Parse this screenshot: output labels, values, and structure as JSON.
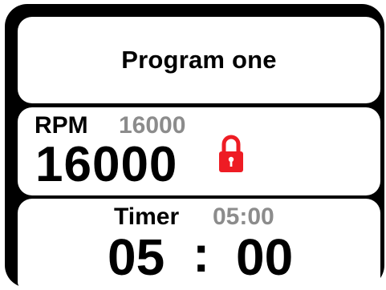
{
  "program": {
    "title": "Program one"
  },
  "rpm": {
    "label": "RPM",
    "setpoint": "16000",
    "value": "16000",
    "lock_icon": "lock-icon",
    "lock_color": "#ee1c24"
  },
  "timer": {
    "label": "Timer",
    "setpoint": "05:00",
    "minutes": "05",
    "separator": ":",
    "seconds": "00"
  },
  "colors": {
    "frame": "#000000",
    "panel": "#ffffff",
    "setpoint_text": "#8c8c8c"
  }
}
